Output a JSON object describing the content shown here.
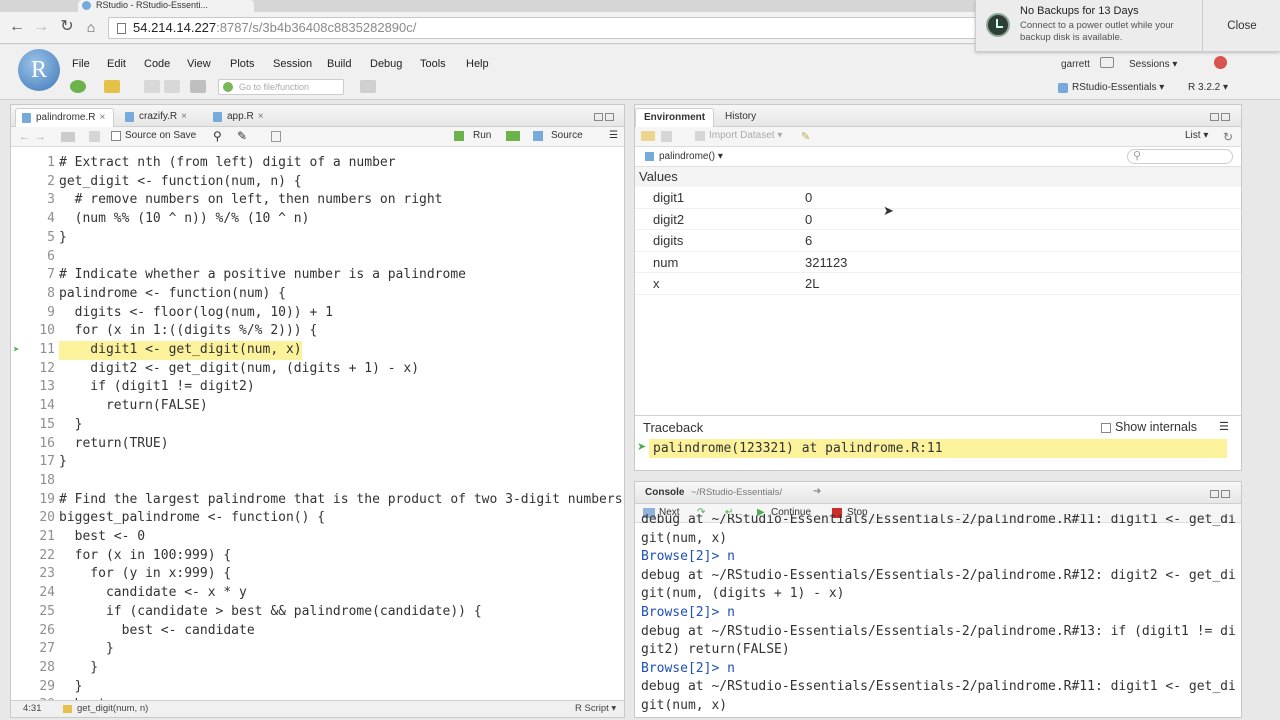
{
  "browser": {
    "tab_title": "RStudio - RStudio-Essenti...",
    "url_host": "54.214.14.227",
    "url_rest": ":8787/s/3b4b36408c8835282890c/"
  },
  "notification": {
    "title": "No Backups for 13 Days",
    "body": "Connect to a power outlet while your backup disk is available.",
    "close_label": "Close"
  },
  "rstudio": {
    "logo": "R",
    "menu": [
      "File",
      "Edit",
      "Code",
      "View",
      "Plots",
      "Session",
      "Build",
      "Debug",
      "Tools",
      "Help"
    ],
    "goto_placeholder": "Go to file/function",
    "user": "garrett",
    "sessions_label": "Sessions ▾",
    "project_label": "RStudio-Essentials ▾",
    "r_version": "R 3.2.2 ▾"
  },
  "editor": {
    "tabs": [
      {
        "label": "palindrome.R"
      },
      {
        "label": "crazify.R"
      },
      {
        "label": "app.R"
      }
    ],
    "source_on_save_label": "Source on Save",
    "run_label": "Run",
    "source_label": "Source",
    "lines": [
      {
        "n": "1",
        "t": "# Extract nth (from left) digit of a number"
      },
      {
        "n": "2",
        "t": "get_digit <- function(num, n) {"
      },
      {
        "n": "3",
        "t": "  # remove numbers on left, then numbers on right"
      },
      {
        "n": "4",
        "t": "  (num %% (10 ^ n)) %/% (10 ^ n)"
      },
      {
        "n": "5",
        "t": "}"
      },
      {
        "n": "6",
        "t": ""
      },
      {
        "n": "7",
        "t": "# Indicate whether a positive number is a palindrome"
      },
      {
        "n": "8",
        "t": "palindrome <- function(num) {"
      },
      {
        "n": "9",
        "t": "  digits <- floor(log(num, 10)) + 1"
      },
      {
        "n": "10",
        "t": "  for (x in 1:((digits %/% 2))) {"
      },
      {
        "n": "11",
        "t": "    digit1 <- get_digit(num, x)"
      },
      {
        "n": "12",
        "t": "    digit2 <- get_digit(num, (digits + 1) - x)"
      },
      {
        "n": "13",
        "t": "    if (digit1 != digit2)"
      },
      {
        "n": "14",
        "t": "      return(FALSE)"
      },
      {
        "n": "15",
        "t": "  }"
      },
      {
        "n": "16",
        "t": "  return(TRUE)"
      },
      {
        "n": "17",
        "t": "}"
      },
      {
        "n": "18",
        "t": ""
      },
      {
        "n": "19",
        "t": "# Find the largest palindrome that is the product of two 3-digit numbers"
      },
      {
        "n": "20",
        "t": "biggest_palindrome <- function() {"
      },
      {
        "n": "21",
        "t": "  best <- 0"
      },
      {
        "n": "22",
        "t": "  for (x in 100:999) {"
      },
      {
        "n": "23",
        "t": "    for (y in x:999) {"
      },
      {
        "n": "24",
        "t": "      candidate <- x * y"
      },
      {
        "n": "25",
        "t": "      if (candidate > best && palindrome(candidate)) {"
      },
      {
        "n": "26",
        "t": "        best <- candidate"
      },
      {
        "n": "27",
        "t": "      }"
      },
      {
        "n": "28",
        "t": "    }"
      },
      {
        "n": "29",
        "t": "  }"
      },
      {
        "n": "30",
        "t": "  best"
      }
    ],
    "status_position": "4:31",
    "status_function": "get_digit(num, n)",
    "status_filetype": "R Script ▾"
  },
  "environment": {
    "tabs": [
      "Environment",
      "History"
    ],
    "import_label": "Import Dataset ▾",
    "list_label": "List ▾",
    "scope_label": "palindrome() ▾",
    "section_label": "Values",
    "values": [
      {
        "name": "digit1",
        "value": "0"
      },
      {
        "name": "digit2",
        "value": "0"
      },
      {
        "name": "digits",
        "value": "6"
      },
      {
        "name": "num",
        "value": "321123"
      },
      {
        "name": "x",
        "value": "2L"
      }
    ]
  },
  "traceback": {
    "title": "Traceback",
    "show_internals_label": "Show internals",
    "frame": "palindrome(123321) at palindrome.R:11"
  },
  "console": {
    "title": "Console",
    "path": "~/RStudio-Essentials/",
    "next_label": "Next",
    "continue_label": "Continue",
    "stop_label": "Stop",
    "lines": [
      {
        "t": "debug at ~/RStudio-Essentials/Essentials-2/palindrome.R#11: digit1 <- get_di",
        "prompt": false
      },
      {
        "t": "git(num, x)",
        "prompt": false
      },
      {
        "t": "Browse[2]> n",
        "prompt": true
      },
      {
        "t": "debug at ~/RStudio-Essentials/Essentials-2/palindrome.R#12: digit2 <- get_di",
        "prompt": false
      },
      {
        "t": "git(num, (digits + 1) - x)",
        "prompt": false
      },
      {
        "t": "Browse[2]> n",
        "prompt": true
      },
      {
        "t": "debug at ~/RStudio-Essentials/Essentials-2/palindrome.R#13: if (digit1 != di",
        "prompt": false
      },
      {
        "t": "git2) return(FALSE)",
        "prompt": false
      },
      {
        "t": "Browse[2]> n",
        "prompt": true
      },
      {
        "t": "debug at ~/RStudio-Essentials/Essentials-2/palindrome.R#11: digit1 <- get_di",
        "prompt": false
      },
      {
        "t": "git(num, x)",
        "prompt": false
      }
    ]
  }
}
